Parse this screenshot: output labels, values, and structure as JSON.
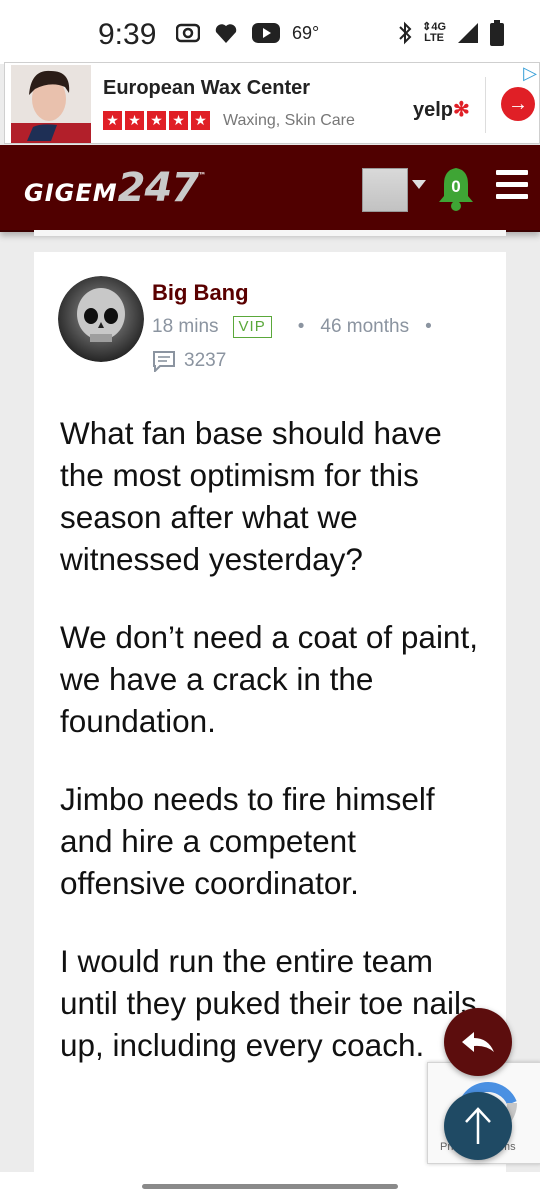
{
  "status_bar": {
    "time": "9:39",
    "temperature": "69°",
    "network": "4G LTE",
    "icons_left": [
      "radio-icon",
      "heart-icon",
      "youtube-icon"
    ],
    "icons_right": [
      "bluetooth-icon",
      "lte-icon",
      "signal-icon",
      "battery-icon"
    ]
  },
  "ad": {
    "title": "European Wax Center",
    "rating_stars": 5,
    "subtitle": "Waxing, Skin Care",
    "brand": "yelp",
    "go_icon": "arrow-right-icon",
    "choices_icon": "adchoices-icon"
  },
  "header": {
    "logo_text_a": "GIGEM",
    "logo_text_b": "247",
    "logo_tm": "™",
    "notification_count": "0",
    "colors": {
      "background": "#500000",
      "bell": "#3fa535"
    }
  },
  "post": {
    "author": "Big Bang",
    "time_ago": "18 mins",
    "badge": "VIP",
    "member_duration": "46 months",
    "post_count": "3237",
    "paragraphs": [
      "What fan base should have the most optimism for this season after what we witnessed yesterday?",
      "We don’t need a coat of paint, we have a crack in the foundation.",
      "Jimbo needs to fire himself and hire a competent offensive coordinator.",
      "I would run the entire team until they puked their toe nails up, including every coach."
    ]
  },
  "overlay": {
    "recaptcha_text": "Privacy - Terms"
  }
}
